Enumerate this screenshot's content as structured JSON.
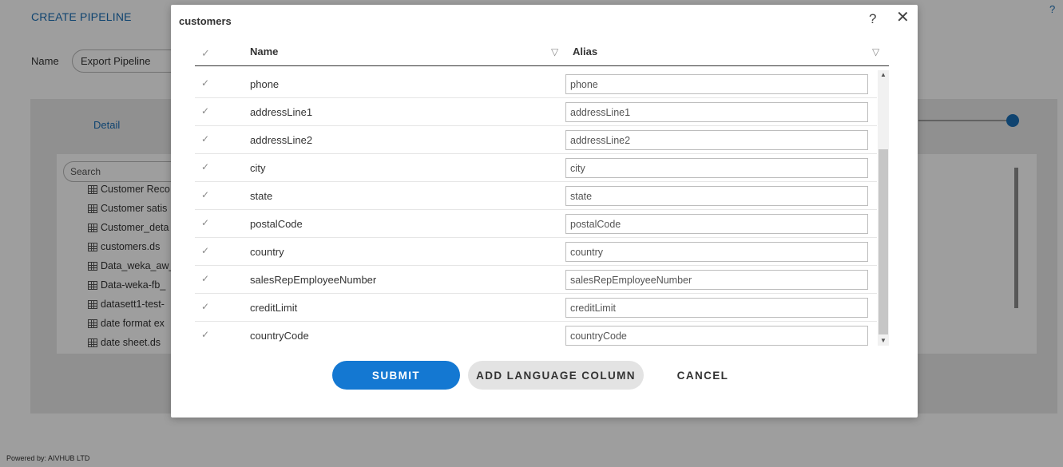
{
  "app": {
    "title": "CREATE PIPELINE",
    "help": "?",
    "name_label": "Name",
    "name_value": "Export Pipeline",
    "detail_tab": "Detail",
    "search_placeholder": "Search",
    "list_items": [
      "Customer Reco",
      "Customer satis",
      "Customer_deta",
      "customers.ds",
      "Data_weka_aw_",
      "Data-weka-fb_",
      "datasett1-test-",
      "date format ex",
      "date sheet.ds"
    ],
    "footer": "Powered by: AIVHUB LTD"
  },
  "modal": {
    "title": "customers",
    "help": "?",
    "close": "✕",
    "columns": {
      "check": "✓",
      "name": "Name",
      "alias": "Alias",
      "filter_icon": "▽"
    },
    "rows": [
      {
        "name": "phone",
        "alias": "phone"
      },
      {
        "name": "addressLine1",
        "alias": "addressLine1"
      },
      {
        "name": "addressLine2",
        "alias": "addressLine2"
      },
      {
        "name": "city",
        "alias": "city"
      },
      {
        "name": "state",
        "alias": "state"
      },
      {
        "name": "postalCode",
        "alias": "postalCode"
      },
      {
        "name": "country",
        "alias": "country"
      },
      {
        "name": "salesRepEmployeeNumber",
        "alias": "salesRepEmployeeNumber"
      },
      {
        "name": "creditLimit",
        "alias": "creditLimit"
      },
      {
        "name": "countryCode",
        "alias": "countryCode"
      }
    ],
    "buttons": {
      "submit": "SUBMIT",
      "add_language": "ADD LANGUAGE COLUMN",
      "cancel": "CANCEL"
    }
  },
  "colors": {
    "accent": "#1478d2",
    "link": "#1a6fb5"
  }
}
